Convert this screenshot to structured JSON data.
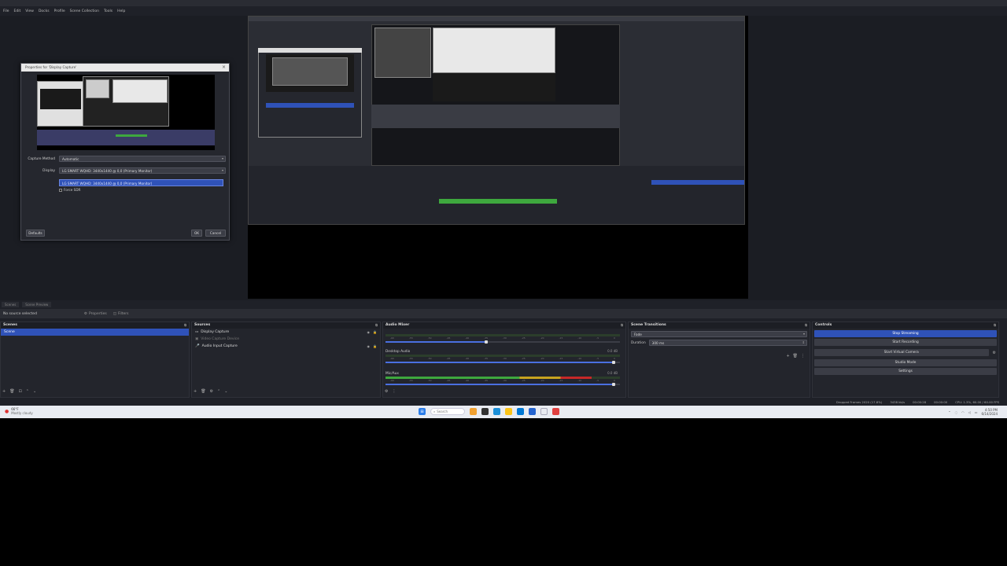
{
  "menu": [
    "File",
    "Edit",
    "View",
    "Docks",
    "Profile",
    "Scene Collection",
    "Tools",
    "Help"
  ],
  "dialog": {
    "title": "Properties for 'Display Capture'",
    "capture_method_label": "Capture Method",
    "capture_method_value": "Automatic",
    "display_label": "Display",
    "display_value": "LG SMART WQHD: 3440x1440 @ 0,0 (Primary Monitor)",
    "dropdown_option": "LG SMART WQHD: 3440x1440 @ 0,0 (Primary Monitor)",
    "force_sdr_label": "Force SDR",
    "defaults_label": "Defaults",
    "ok_label": "OK",
    "cancel_label": "Cancel"
  },
  "status_tabs": [
    "Scenes",
    "Scene Preview"
  ],
  "source_bar": {
    "no_source": "No source selected",
    "properties": "Properties",
    "filters": "Filters"
  },
  "docks": {
    "scenes": {
      "title": "Scenes",
      "items": [
        "Scene"
      ]
    },
    "sources": {
      "title": "Sources",
      "items": [
        "Display Capture",
        "Video Capture Device",
        "Audio Input Capture"
      ]
    },
    "mixer": {
      "title": "Audio Mixer",
      "tracks": [
        {
          "name": "",
          "db": "",
          "level": 0.0,
          "volume": 0.43
        },
        {
          "name": "Desktop Audio",
          "db": "0.0 dB",
          "level": 0.0,
          "volume": 0.98
        },
        {
          "name": "Mic/Aux",
          "db": "0.0 dB",
          "level": 0.88,
          "volume": 0.98
        }
      ],
      "ticks": [
        "-60",
        "-55",
        "-50",
        "-45",
        "-40",
        "-35",
        "-30",
        "-25",
        "-20",
        "-15",
        "-10",
        "-5",
        "0"
      ]
    },
    "transitions": {
      "title": "Scene Transitions",
      "transition_value": "Fade",
      "duration_label": "Duration",
      "duration_value": "300 ms"
    },
    "controls": {
      "title": "Controls",
      "buttons": [
        "Stop Streaming",
        "Start Recording",
        "Start Virtual Camera",
        "Studio Mode",
        "Settings"
      ]
    }
  },
  "obs_status": {
    "dropped": "Dropped Frames 2020 (17.8%)",
    "bitrate": "3438 kb/s",
    "live_time": "00:00:28",
    "rec_time": "00:00:00",
    "cpu": "CPU: 1.3%, 60.00 / 60.00 FPS"
  },
  "taskbar": {
    "weather_temp": "66°F",
    "weather_desc": "Mostly cloudy",
    "search_placeholder": "Search",
    "time": "4:50 PM",
    "date": "6/14/2024"
  },
  "colors": {
    "accent": "#2f52b8",
    "meter_green": "#3ea83e",
    "meter_yellow": "#c7a31f",
    "meter_red": "#c62828"
  }
}
